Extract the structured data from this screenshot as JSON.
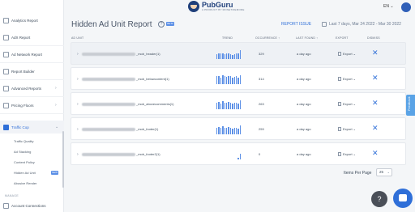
{
  "header": {
    "brand_name": "PubGuru",
    "brand_tagline": "A PRODUCT BY MONETIZEMORE",
    "language": "EN ⌄"
  },
  "sidebar": {
    "items": [
      {
        "label": "Analytics Report",
        "chevron": ""
      },
      {
        "label": "AdX Report",
        "chevron": ""
      },
      {
        "label": "Ad Network Report",
        "chevron": ""
      },
      {
        "label": "Report Builder",
        "chevron": ""
      },
      {
        "label": "Advanced Reports",
        "chevron": "›"
      },
      {
        "label": "Pricing Floors",
        "chevron": "›"
      },
      {
        "label": "Traffic Cop",
        "chevron": "⌄"
      }
    ],
    "sub_items": [
      "Traffic Quality",
      "Ad Stacking",
      "Content Policy",
      "Hidden Ad Unit",
      "Abusive Render"
    ],
    "new_badge": "NEW",
    "section_label": "MANAGE",
    "bottom_item": "Account Connections"
  },
  "main": {
    "title": "Hidden Ad Unit Report",
    "title_badge": "BETA",
    "report_issue": "REPORT ISSUE",
    "date_range": "Last 7 days, Mar 24 2022 - Mar 30 2022",
    "columns": {
      "ad_unit": "AD UNIT",
      "trend": "TREND",
      "occurrence": "OCCURRENCE ↑",
      "last_found": "LAST FOUND ↑",
      "export": "EXPORT",
      "dismiss": "DISMISS"
    },
    "rows": [
      {
        "name": "_mob_header(1)",
        "occurrence": "329",
        "last_found": "a day ago",
        "export": "Export ⌄",
        "trend": [
          0.5,
          0.6,
          0.55,
          0.6,
          0.5,
          0.55,
          0.6,
          0.5,
          0.45,
          0.5,
          0.55,
          0.6,
          0.9
        ]
      },
      {
        "name": "_mob_belowcontent(1)",
        "occurrence": "314",
        "last_found": "a day ago",
        "export": "Export ⌄",
        "trend": [
          0.8,
          0.85,
          0.7,
          0.9,
          0.8,
          0.75,
          0.85,
          0.8,
          0.7,
          0.75,
          0.8,
          0.7,
          0.95
        ]
      },
      {
        "name": "_mob_abovecomments(1)",
        "occurrence": "263",
        "last_found": "a day ago",
        "export": "Export ⌄",
        "trend": [
          0.7,
          0.75,
          0.6,
          0.8,
          0.7,
          0.65,
          0.75,
          0.7,
          0.6,
          0.65,
          0.7,
          0.6,
          0.9
        ]
      },
      {
        "name": "_mob_footer(1)",
        "occurrence": "259",
        "last_found": "a day ago",
        "export": "Export ⌄",
        "trend": [
          0.7,
          0.75,
          0.65,
          0.8,
          0.7,
          0.65,
          0.75,
          0.7,
          0.6,
          0.65,
          0.7,
          0.6,
          0.9
        ]
      },
      {
        "name": "_mob_footer2(1)",
        "occurrence": "0",
        "last_found": "a day ago",
        "export": "Export ⌄",
        "trend": [
          0,
          0,
          0,
          0,
          0,
          0,
          0,
          0,
          0,
          0,
          0,
          0.15,
          0.6
        ]
      }
    ],
    "dismiss_symbol": "✕",
    "items_per_page_label": "Items Per Page",
    "items_per_page_value": "25"
  },
  "feedback_label": "Feedback",
  "help_symbol": "?",
  "colors": {
    "accent": "#2f6fd8",
    "trend_bar": "#5b8fe6",
    "highlight_row": "#eef1f5"
  }
}
